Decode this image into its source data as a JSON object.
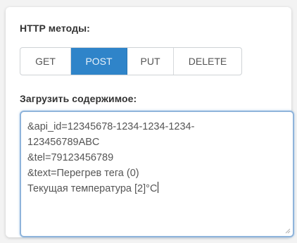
{
  "methods_section": {
    "label": "HTTP методы:",
    "buttons": [
      {
        "label": "GET",
        "active": false
      },
      {
        "label": "POST",
        "active": true
      },
      {
        "label": "PUT",
        "active": false
      },
      {
        "label": "DELETE",
        "active": false
      }
    ]
  },
  "upload_section": {
    "label": "Загрузить содержимое:",
    "lines": [
      "&api_id=12345678-1234-1234-1234-",
      "123456789ABC",
      "&tel=79123456789",
      "&text=Перегрев тега (0)",
      "Текущая температура [2]°C"
    ]
  },
  "colors": {
    "active_button": "#2f84c9",
    "focus_border": "#8fb4db"
  }
}
